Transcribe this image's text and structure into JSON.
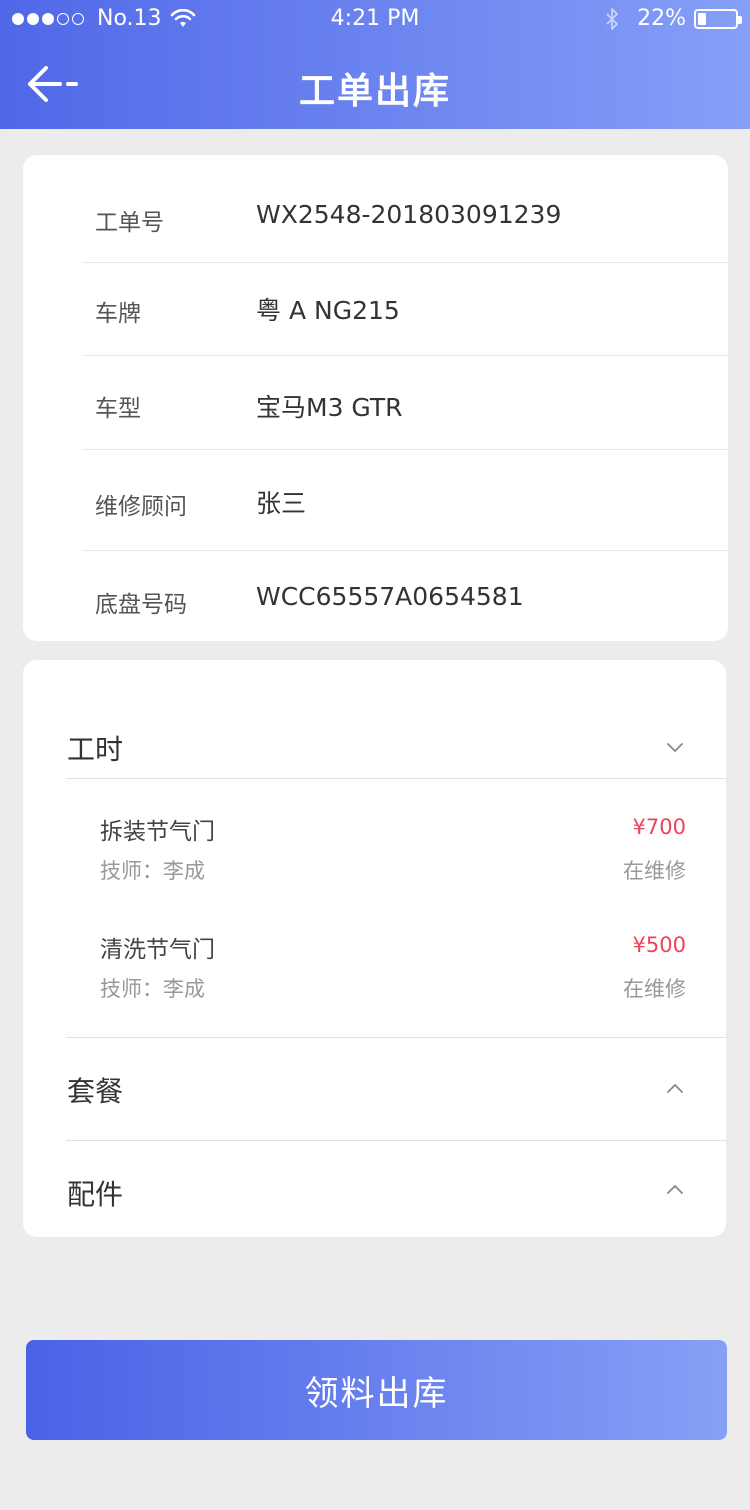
{
  "status_bar": {
    "carrier": "No.13",
    "time": "4:21 PM",
    "battery": "22%",
    "battery_level": 0.22,
    "signal_dots": 5,
    "signal_filled": 3
  },
  "header": {
    "title": "工单出库",
    "back_icon": "arrow-left-icon",
    "gradient": [
      "#5068e8",
      "#869ff7"
    ]
  },
  "info": {
    "rows": [
      {
        "label": "工单号",
        "value": "WX2548-201803091239"
      },
      {
        "label": "车牌",
        "value": "粤 A NG215"
      },
      {
        "label": "车型",
        "value": "宝马M3 GTR"
      },
      {
        "label": "维修顾问",
        "value": "张三"
      },
      {
        "label": "底盘号码",
        "value": "WCC65557A0654581"
      }
    ]
  },
  "sections": {
    "labor": {
      "title": "工时",
      "expanded": true,
      "items": [
        {
          "name": "拆装节气门",
          "tech": "技师：李成",
          "price": "¥700",
          "status": "在维修"
        },
        {
          "name": "清洗节气门",
          "tech": "技师：李成",
          "price": "¥500",
          "status": "在维修"
        }
      ]
    },
    "package": {
      "title": "套餐",
      "expanded": false
    },
    "parts": {
      "title": "配件",
      "expanded": false
    }
  },
  "colors": {
    "price": "#f0425a",
    "accent": "#5068e8"
  },
  "action": {
    "submit_label": "领料出库"
  }
}
